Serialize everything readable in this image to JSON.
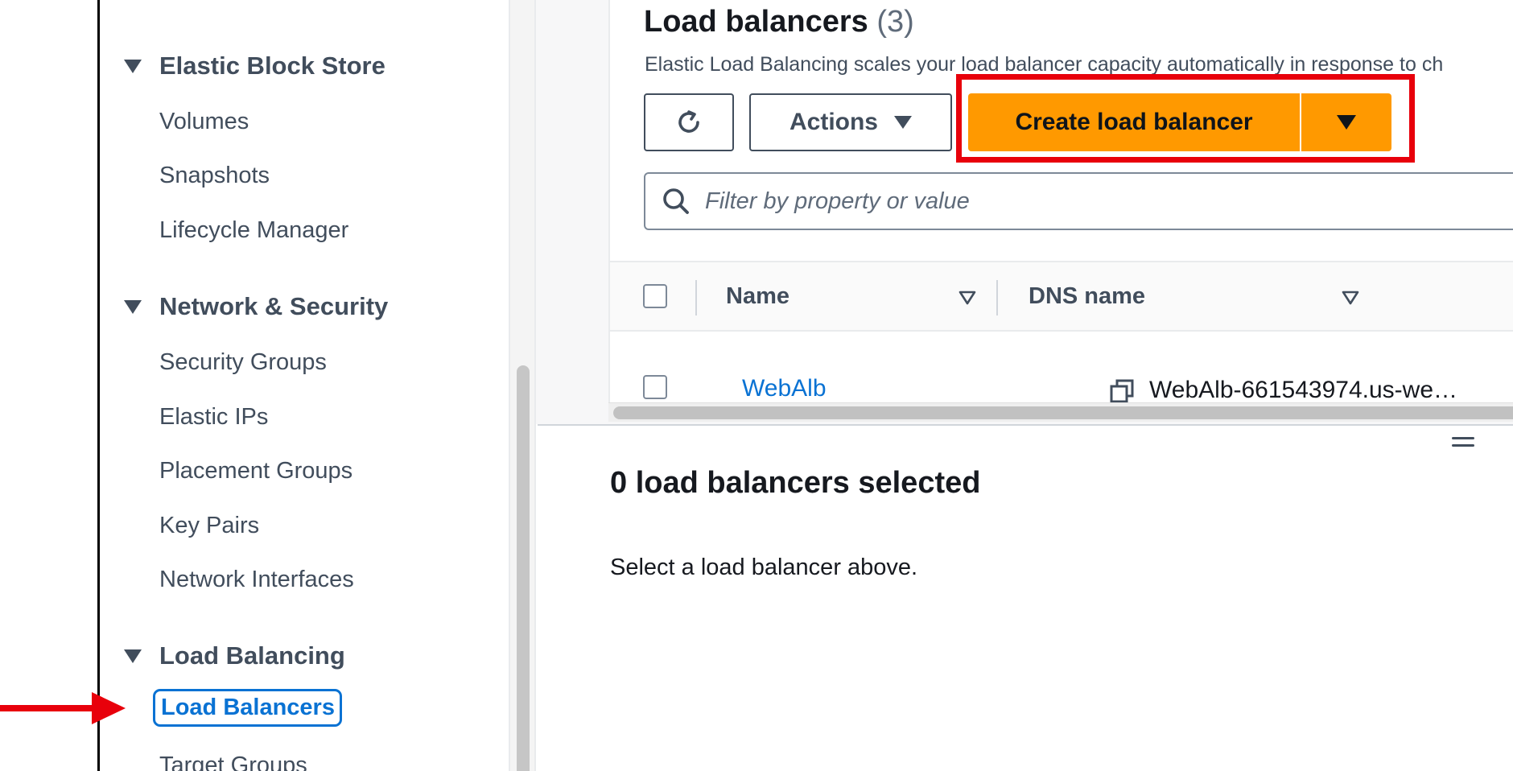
{
  "sidebar": {
    "sections": [
      {
        "title": "Elastic Block Store",
        "items": [
          "Volumes",
          "Snapshots",
          "Lifecycle Manager"
        ]
      },
      {
        "title": "Network & Security",
        "items": [
          "Security Groups",
          "Elastic IPs",
          "Placement Groups",
          "Key Pairs",
          "Network Interfaces"
        ]
      },
      {
        "title": "Load Balancing",
        "items": [
          "Load Balancers",
          "Target Groups"
        ]
      }
    ],
    "active_item": "Load Balancers"
  },
  "header": {
    "title": "Load balancers",
    "count": "(3)",
    "description": "Elastic Load Balancing scales your load balancer capacity automatically in response to ch"
  },
  "toolbar": {
    "refresh_icon": "refresh-icon",
    "actions_label": "Actions",
    "create_label": "Create load balancer"
  },
  "filter": {
    "placeholder": "Filter by property or value"
  },
  "table": {
    "columns": [
      "Name",
      "DNS name"
    ],
    "rows": [
      {
        "name": "WebAlb",
        "dns": "WebAlb-661543974.us-we…"
      }
    ]
  },
  "split_panel": {
    "title": "0 load balancers selected",
    "message": "Select a load balancer above."
  },
  "colors": {
    "accent": "#ff9900",
    "link": "#0972d3",
    "highlight": "#e8000b"
  }
}
